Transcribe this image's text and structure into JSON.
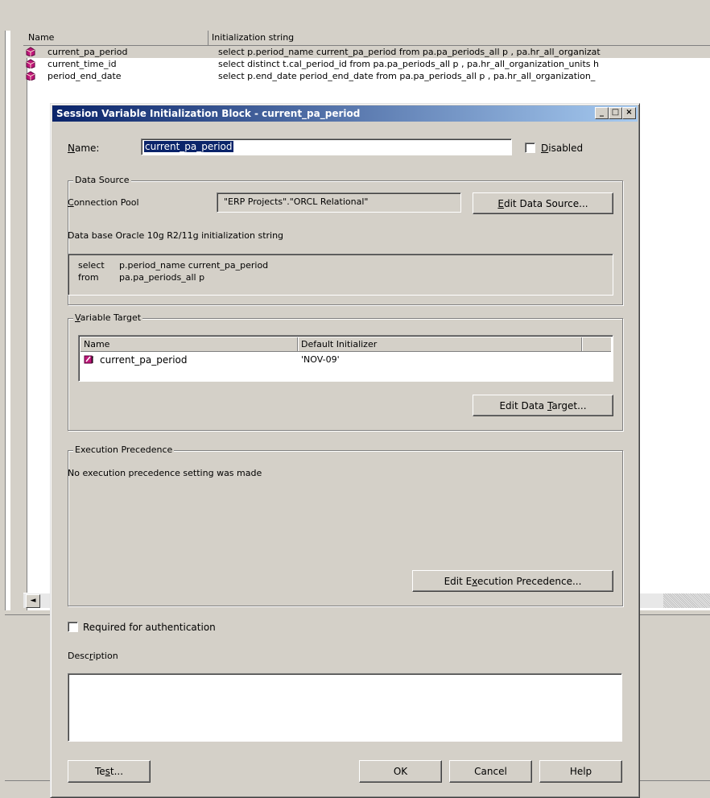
{
  "background_list": {
    "columns": [
      "Name",
      "Initialization string"
    ],
    "rows": [
      {
        "name": "current_pa_period",
        "init": "select    p.period_name current_pa_period from    pa.pa_periods_all p    , pa.hr_all_organizat"
      },
      {
        "name": "current_time_id",
        "init": "select    distinct t.cal_period_id from    pa.pa_periods_all p    , pa.hr_all_organization_units h"
      },
      {
        "name": "period_end_date",
        "init": "select    p.end_date period_end_date from    pa.pa_periods_all p    , pa.hr_all_organization_"
      }
    ],
    "scroll_left": "◄"
  },
  "dialog": {
    "title": "Session Variable Initialization Block - current_pa_period",
    "window_buttons": {
      "minimize": "_",
      "maximize": "□",
      "close": "×"
    },
    "name_label": "Name:",
    "name_value": "current_pa_period",
    "disabled_label": "Disabled",
    "disabled_checked": false,
    "data_source": {
      "legend": "Data Source",
      "connection_pool_label": "Connection Pool",
      "connection_pool_value": "\"ERP Projects\".\"ORCL Relational\"",
      "edit_button": "Edit Data Source...",
      "init_string_label": "Data base Oracle 10g R2/11g initialization string",
      "sql_line1_kw": "select",
      "sql_line1": "p.period_name current_pa_period",
      "sql_line2_kw": "from",
      "sql_line2": "pa.pa_periods_all p"
    },
    "variable_target": {
      "legend": "Variable Target",
      "col_name": "Name",
      "col_default": "Default Initializer",
      "rows": [
        {
          "name": "current_pa_period",
          "default": "'NOV-09'"
        }
      ],
      "edit_button": "Edit Data Target..."
    },
    "execution": {
      "legend": "Execution Precedence",
      "message": "No execution precedence setting was made",
      "edit_button": "Edit Execution Precedence..."
    },
    "required_auth_label": "Required for authentication",
    "required_auth_checked": false,
    "description_label": "Description",
    "description_value": "",
    "buttons": {
      "test": "Test...",
      "ok": "OK",
      "cancel": "Cancel",
      "help": "Help"
    }
  }
}
